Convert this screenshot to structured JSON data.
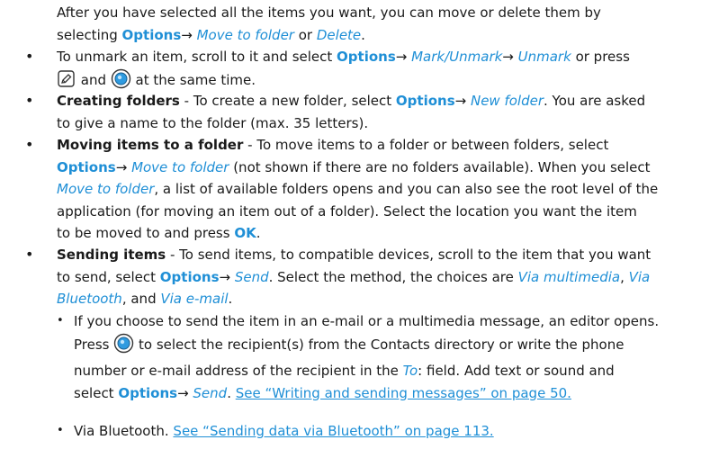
{
  "colors": {
    "accent": "#1f8fd6",
    "text": "#1a1a1a"
  },
  "icons": {
    "edit_key": "pencil-key-icon",
    "joystick": "scroll-key-icon"
  },
  "bullet": "•",
  "arrow": "→",
  "p0": {
    "l1": "After you have selected all the items you want, you can move or delete them by",
    "l2a": "selecting ",
    "l2b": "Options",
    "l2c": "→",
    "l2d": " Move to folder",
    "l2e": " or ",
    "l2f": "Delete",
    "l2g": "."
  },
  "p1": {
    "a": "To unmark an item, scroll to it and select ",
    "b": "Options",
    "c": "→",
    "d": " Mark/Unmark",
    "e": "→",
    "f": " Unmark",
    "g": " or press",
    "h": " and ",
    "i": " at the same time."
  },
  "p2": {
    "bold": "Creating folders",
    "a": " - To create a new folder, select ",
    "b": "Options",
    "c": "→",
    "d": " New folder",
    "e": ". You are asked",
    "l2": "to give a name to the folder (max. 35 letters)."
  },
  "p3": {
    "bold": "Moving items to a folder",
    "a": " - To move items to a folder or between folders, select",
    "b": "Options",
    "c": "→",
    "d": " Move to folder",
    "e": " (not shown if there are no folders available). When you select",
    "f": "Move to folder",
    "g": ", a list of available folders opens and you can also see the root level of the",
    "l4": "application (for moving an item out of a folder). Select the location you want the item",
    "h": "to be moved to and press ",
    "i": "OK",
    "j": "."
  },
  "p4": {
    "bold": "Sending items",
    "a": " - To send items, to compatible devices, scroll to the item that you want",
    "b": "to send, select ",
    "c": "Options",
    "d": "→",
    "e": " Send",
    "f": ". Select the method, the choices are ",
    "g": "Via multimedia",
    "h": ", ",
    "i": "Via",
    "j": "Bluetooth",
    "k": ", and ",
    "l": "Via e-mail",
    "m": "."
  },
  "p5": {
    "l1": "If you choose to send the item in an e-mail or a multimedia message, an editor opens.",
    "a": "Press ",
    "b": " to select the recipient(s) from the Contacts directory or write the phone",
    "l3a": "number or e-mail address of the recipient in the ",
    "l3b": "To",
    "l3c": ": field. Add text or sound and",
    "c": "select ",
    "d": "Options",
    "e": "→",
    "f": " Send",
    "g": ". ",
    "h": "See “Writing and sending messages” on page 50."
  },
  "p6": {
    "a": "Via Bluetooth. ",
    "b": "See “Sending data via Bluetooth” on page 113."
  }
}
